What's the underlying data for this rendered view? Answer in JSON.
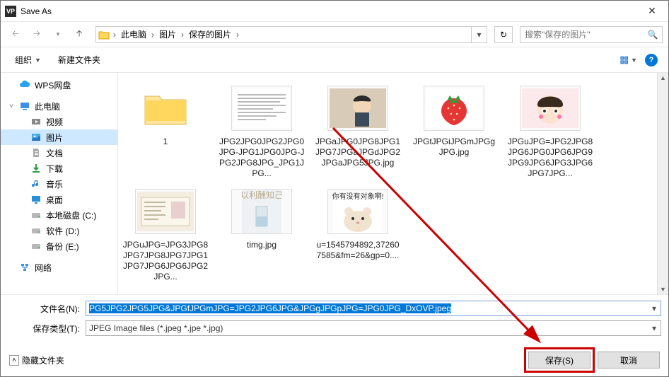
{
  "window": {
    "title": "Save As",
    "app_icon_text": "VP"
  },
  "nav": {
    "breadcrumb": [
      "此电脑",
      "图片",
      "保存的图片"
    ],
    "search_placeholder": "搜索\"保存的图片\"",
    "refresh_title": "刷新"
  },
  "toolbar": {
    "organize": "组织",
    "new_folder": "新建文件夹",
    "help": "?"
  },
  "sidebar": {
    "items": [
      {
        "label": "WPS网盘",
        "icon": "cloud",
        "indent": 0
      },
      {
        "label": "此电脑",
        "icon": "pc",
        "indent": 0,
        "expandable": true
      },
      {
        "label": "视频",
        "icon": "video",
        "indent": 1
      },
      {
        "label": "图片",
        "icon": "pic",
        "indent": 1,
        "active": true
      },
      {
        "label": "文档",
        "icon": "doc",
        "indent": 1
      },
      {
        "label": "下载",
        "icon": "down",
        "indent": 1
      },
      {
        "label": "音乐",
        "icon": "music",
        "indent": 1
      },
      {
        "label": "桌面",
        "icon": "desktop",
        "indent": 1
      },
      {
        "label": "本地磁盘 (C:)",
        "icon": "disk",
        "indent": 1
      },
      {
        "label": "软件 (D:)",
        "icon": "disk",
        "indent": 1
      },
      {
        "label": "备份 (E:)",
        "icon": "disk",
        "indent": 1
      },
      {
        "label": "网络",
        "icon": "net",
        "indent": 0
      }
    ]
  },
  "files": [
    {
      "name": "1",
      "type": "folder"
    },
    {
      "name": "JPG2JPG0JPG2JPG0JPG-JPG1JPG0JPG-JPG2JPG8JPG_JPG1JPG...",
      "type": "image",
      "thumb": "textdoc"
    },
    {
      "name": "JPGaJPG0JPG8JPG1JPG7JPGaJPGdJPG2JPGaJPG5JPG.jpg",
      "type": "image",
      "thumb": "boy"
    },
    {
      "name": "JPGtJPGiJPGmJPGgJPG.jpg",
      "type": "image",
      "thumb": "strawberry"
    },
    {
      "name": "JPGuJPG=JPG2JPG8JPG6JPG0JPG6JPG9JPG9JPG6JPG3JPG6JPG7JPG...",
      "type": "image",
      "thumb": "cartoon"
    },
    {
      "name": "JPGuJPG=JPG3JPG8JPG7JPG8JPG7JPG1JPG7JPG6JPG6JPG2JPG...",
      "type": "image",
      "thumb": "idcard"
    },
    {
      "name": "timg.jpg",
      "type": "image",
      "thumb": "glass"
    },
    {
      "name": "u=1545794892,372607585&fm=26&gp=0....",
      "type": "image",
      "thumb": "hamster",
      "caption": "你有没有对象啊!"
    }
  ],
  "form": {
    "filename_label": "文件名(N):",
    "filename_value": "PG5JPG2JPG5JPG&JPGfJPGmJPG=JPG2JPG6JPG&JPGgJPGpJPG=JPG0JPG_DxOVP.jpeg",
    "filetype_label": "保存类型(T):",
    "filetype_value": "JPEG Image files (*.jpeg *.jpe *.jpg)"
  },
  "footer": {
    "hide_folders": "隐藏文件夹",
    "save": "保存(S)",
    "cancel": "取消"
  }
}
